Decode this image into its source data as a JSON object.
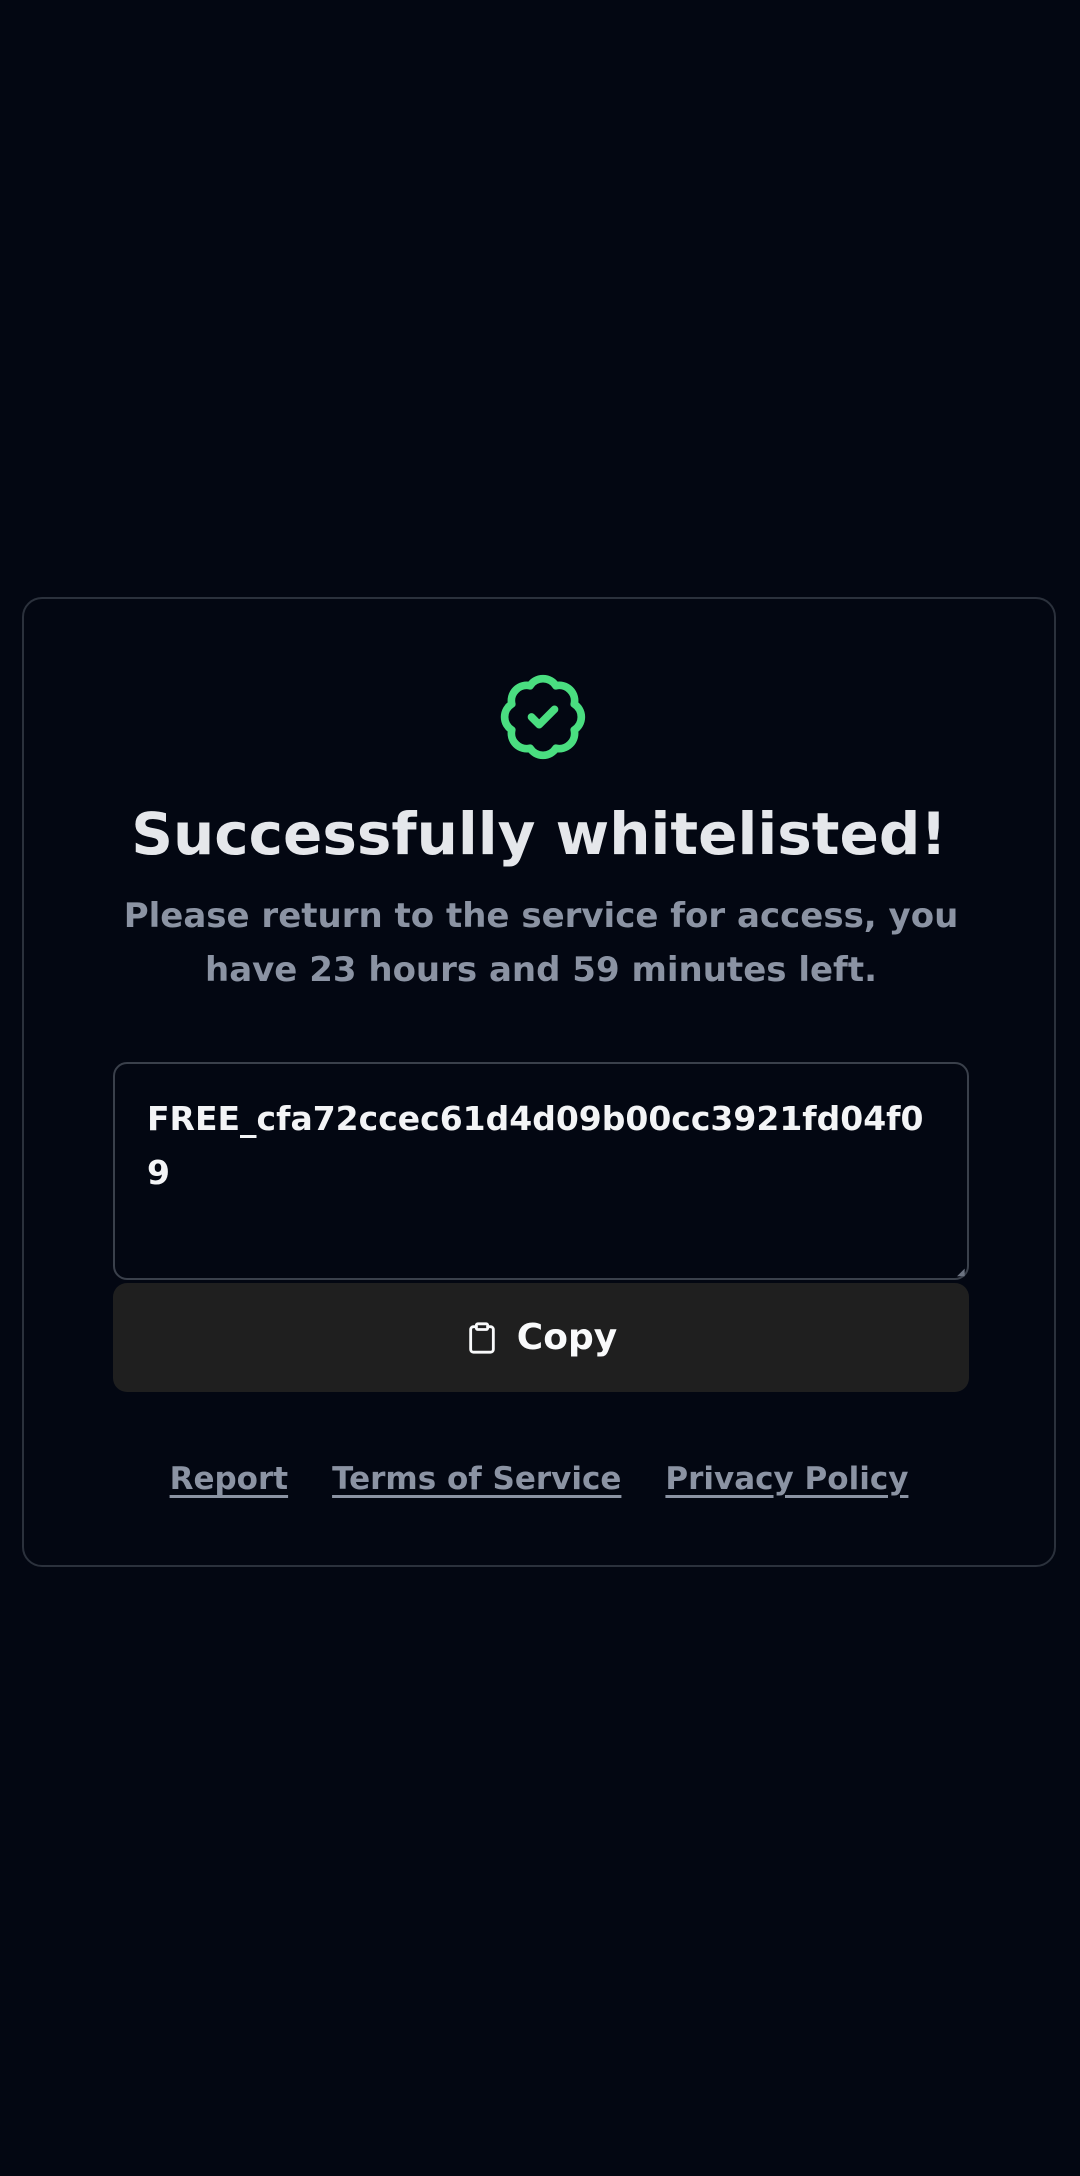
{
  "status": {
    "icon": "badge-check-icon",
    "icon_color": "#4ade80",
    "title": "Successfully whitelisted!",
    "message": "Please return to the service for access, you have 23 hours and 59 minutes left."
  },
  "key": {
    "value": "FREE_cfa72ccec61d4d09b00cc3921fd04f09"
  },
  "copy_button": {
    "icon": "clipboard-icon",
    "label": "Copy"
  },
  "footer": {
    "links": [
      "Report",
      "Terms of Service",
      "Privacy Policy"
    ]
  }
}
